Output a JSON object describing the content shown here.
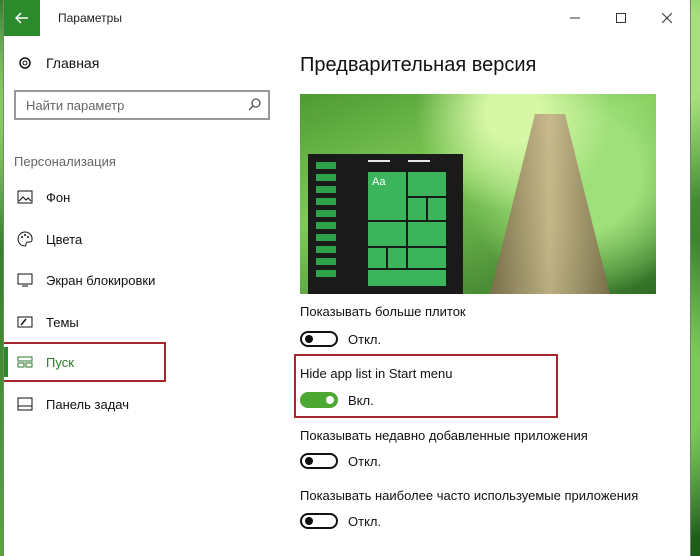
{
  "window": {
    "title": "Параметры"
  },
  "sidebar": {
    "home_label": "Главная",
    "search_placeholder": "Найти параметр",
    "section_label": "Персонализация",
    "items": [
      {
        "label": "Фон",
        "icon": "picture-icon"
      },
      {
        "label": "Цвета",
        "icon": "palette-icon"
      },
      {
        "label": "Экран блокировки",
        "icon": "lock-screen-icon"
      },
      {
        "label": "Темы",
        "icon": "themes-icon"
      },
      {
        "label": "Пуск",
        "icon": "start-icon",
        "active": true
      },
      {
        "label": "Панель задач",
        "icon": "taskbar-icon"
      }
    ]
  },
  "main": {
    "title": "Предварительная версия",
    "preview": {
      "tile_text": "Aa"
    },
    "settings": [
      {
        "label": "Показывать больше плиток",
        "state": "Откл.",
        "on": false
      },
      {
        "label": "Hide app list in Start menu",
        "state": "Вкл.",
        "on": true
      },
      {
        "label": "Показывать недавно добавленные приложения",
        "state": "Откл.",
        "on": false
      },
      {
        "label": "Показывать наиболее часто используемые приложения",
        "state": "Откл.",
        "on": false
      }
    ]
  },
  "colors": {
    "accent": "#2a8a2c",
    "highlight_box": "#a3282f",
    "toggle_on": "#4da832"
  }
}
